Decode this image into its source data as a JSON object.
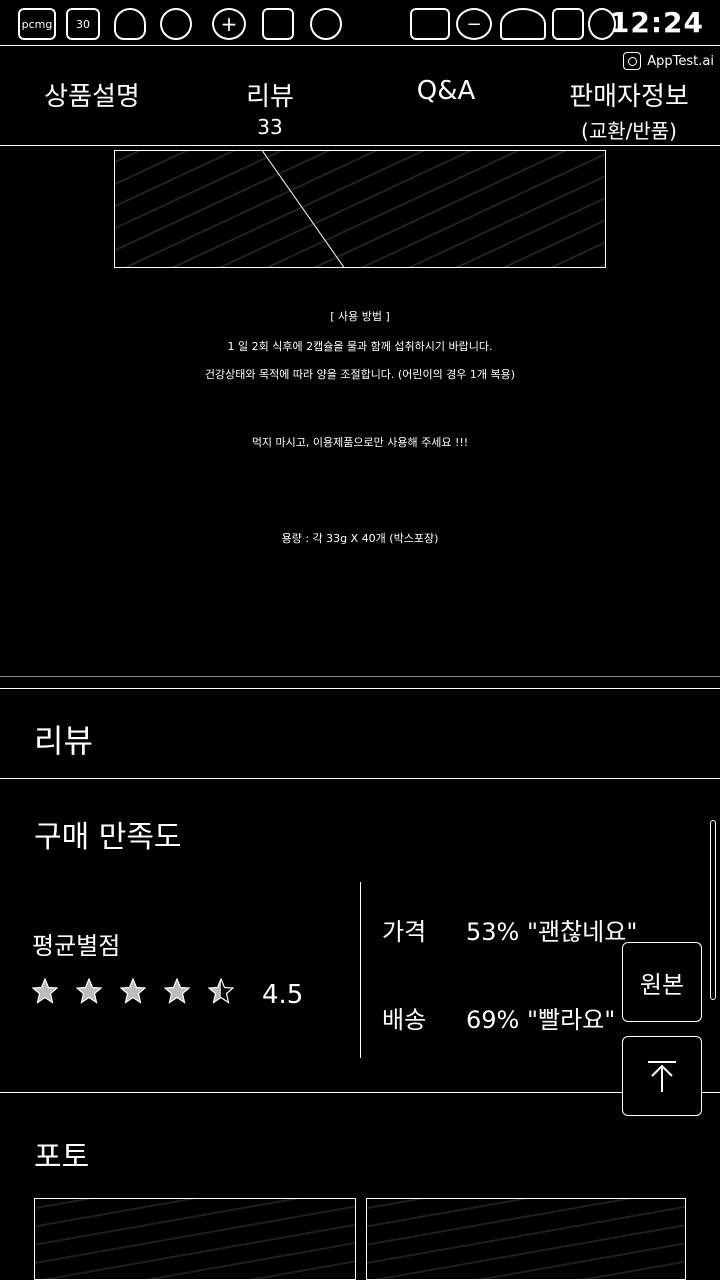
{
  "status_bar": {
    "left_icons": [
      "pcmg-icon",
      "calendar-icon",
      "leaf-icon",
      "chat-icon",
      "plus-icon",
      "flag-icon",
      "circle-icon"
    ],
    "right_icons": [
      "cast-icon",
      "minus-circle-icon",
      "wifi-icon",
      "signal-icon",
      "battery-icon"
    ],
    "pcmg_label": "pcmg",
    "calendar_label": "30",
    "time": "12:24"
  },
  "apptest": {
    "label": "AppTest.ai"
  },
  "tabs": [
    {
      "label": "상품설명",
      "sub": ""
    },
    {
      "label": "리뷰",
      "sub": "33"
    },
    {
      "label": "Q&A",
      "sub": ""
    },
    {
      "label": "판매자정보",
      "sub": "(교환/반품)"
    }
  ],
  "description": {
    "lines": [
      "[ 사용 방법 ]",
      "1 일 2회 식후에 2캡슐을 물과 함께 섭취하시기 바랍니다.",
      "건강상태와 목적에 따라 양을 조절합니다. (어린이의 경우 1개 복용)",
      "먹지 마시고, 이용제품으로만 사용해 주세요 !!!",
      "용량 : 각 33g X 40개 (박스포장)"
    ]
  },
  "review": {
    "title": "리뷰",
    "satisfaction_title": "구매 만족도",
    "average_label": "평균별점",
    "rating": "4.5",
    "rating_value": 4.5,
    "metrics": [
      {
        "label": "가격",
        "value": "53%",
        "comment": "\"괜찮네요\""
      },
      {
        "label": "배송",
        "value": "69%",
        "comment": "\"빨라요\""
      }
    ]
  },
  "buttons": {
    "original": "원본"
  },
  "photos": {
    "title": "포토"
  }
}
